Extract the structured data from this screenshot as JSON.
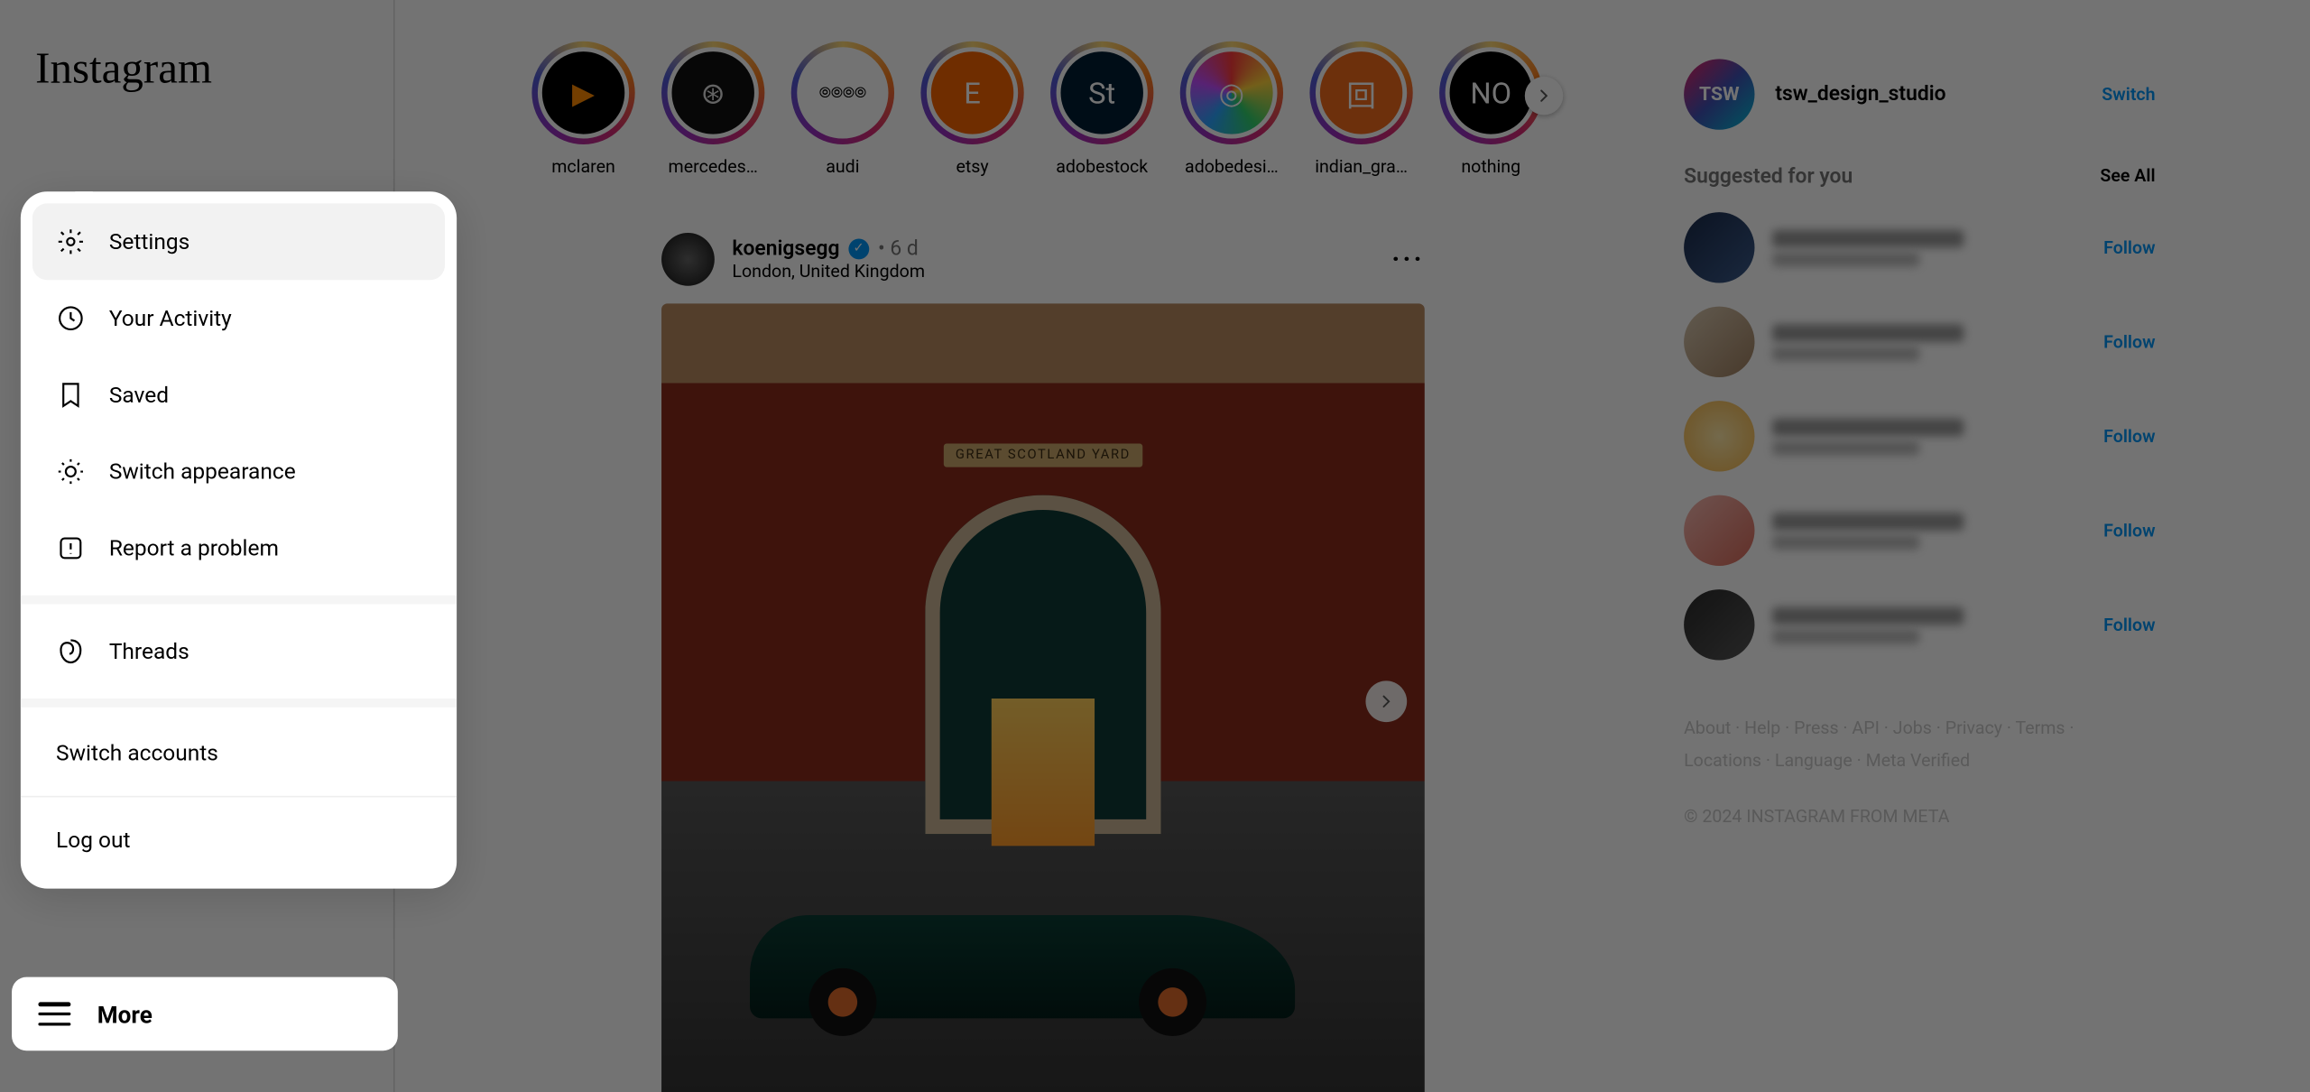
{
  "logo_text": "Instagram",
  "more_button_label": "More",
  "popup": {
    "settings": "Settings",
    "your_activity": "Your Activity",
    "saved": "Saved",
    "switch_appearance": "Switch appearance",
    "report_problem": "Report a problem",
    "threads": "Threads",
    "switch_accounts": "Switch accounts",
    "log_out": "Log out"
  },
  "stories": [
    {
      "label": "mclaren",
      "bg": "#000",
      "fg": "#ff8a00",
      "letter": "▶"
    },
    {
      "label": "mercedes…",
      "bg": "#111",
      "fg": "#ddd",
      "letter": "⊛"
    },
    {
      "label": "audi",
      "bg": "#fff",
      "fg": "#000",
      "letter": "⦾⦾⦾⦾"
    },
    {
      "label": "etsy",
      "bg": "#f56400",
      "fg": "#fff",
      "letter": "E"
    },
    {
      "label": "adobestock",
      "bg": "#001d34",
      "fg": "#fff",
      "letter": "St"
    },
    {
      "label": "adobedesi…",
      "bg": "conic-gradient(#ff3b3b,#ffd23b,#31d06c,#2aa4ff,#c24dff,#ff3b3b)",
      "fg": "#fff",
      "letter": "◎"
    },
    {
      "label": "indian_gra…",
      "bg": "#f26a1b",
      "fg": "#fff",
      "letter": "回"
    },
    {
      "label": "nothing",
      "bg": "#000",
      "fg": "#fff",
      "letter": "NO"
    }
  ],
  "post": {
    "username": "koenigsegg",
    "time": "6 d",
    "location": "London, United Kingdom",
    "sign_text": "GREAT SCOTLAND YARD"
  },
  "me": {
    "username": "tsw_design_studio",
    "avatar_text": "TSW",
    "switch_label": "Switch"
  },
  "suggested": {
    "title": "Suggested for you",
    "see_all": "See All",
    "follow_label": "Follow",
    "items": [
      {
        "avatar_bg": "linear-gradient(135deg,#1a2a4a,#3a5a8a)"
      },
      {
        "avatar_bg": "linear-gradient(135deg,#d8c8b0,#a08060)"
      },
      {
        "avatar_bg": "radial-gradient(circle,#ffe9a8,#f4b549)"
      },
      {
        "avatar_bg": "linear-gradient(135deg,#f5b8b0,#d86a5a)"
      },
      {
        "avatar_bg": "linear-gradient(135deg,#2a2a2a,#555)"
      }
    ]
  },
  "footer": {
    "links": [
      "About",
      "Help",
      "Press",
      "API",
      "Jobs",
      "Privacy",
      "Terms",
      "Locations",
      "Language",
      "Meta Verified"
    ],
    "copyright": "© 2024 INSTAGRAM FROM META"
  }
}
